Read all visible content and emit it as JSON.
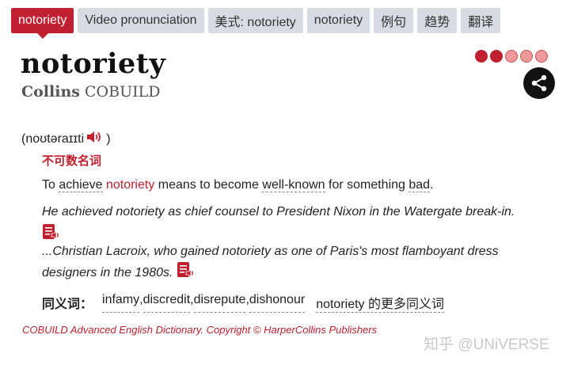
{
  "tabs": [
    {
      "label": "notoriety",
      "active": true
    },
    {
      "label": "Video pronunciation"
    },
    {
      "label": "美式: notoriety"
    },
    {
      "label": "notoriety"
    },
    {
      "label": "例句"
    },
    {
      "label": "趋势"
    },
    {
      "label": "翻译"
    }
  ],
  "entry": {
    "headword": "notoriety",
    "brand_bold": "Collins",
    "brand_rest": " COBUILD",
    "frequency": {
      "filled": 2,
      "total": 5
    },
    "pronunciation": {
      "open": "(",
      "ipa": "noʊtəraɪɪti",
      "close": ")"
    },
    "part_of_speech": "不可数名词",
    "definition": {
      "p1": "To ",
      "w1": "achieve",
      "p2": " ",
      "w2": "notoriety",
      "p3": " means to become ",
      "w3": "well-known",
      "p4": " for something ",
      "w4": "bad",
      "p5": "."
    },
    "examples": [
      "He achieved notoriety as chief counsel to President Nixon in the Watergate break-in.",
      "...Christian Lacroix, who gained notoriety as one of Paris's most flamboyant dress designers in the 1980s."
    ],
    "synonyms": {
      "label": "同义词：",
      "items": [
        "infamy",
        "discredit",
        "disrepute",
        "dishonour"
      ],
      "separator": ", ",
      "more": "notoriety 的更多同义词"
    },
    "copyright": "COBUILD Advanced English Dictionary. Copyright © HarperCollins Publishers"
  },
  "watermark": "知乎 @UNiVERSE",
  "colors": {
    "accent": "#c0202f",
    "tab_bg": "#d7dce3"
  },
  "icons": {
    "share": "share-icon",
    "speaker": "speaker-icon",
    "audio_example": "audio-example-icon"
  }
}
